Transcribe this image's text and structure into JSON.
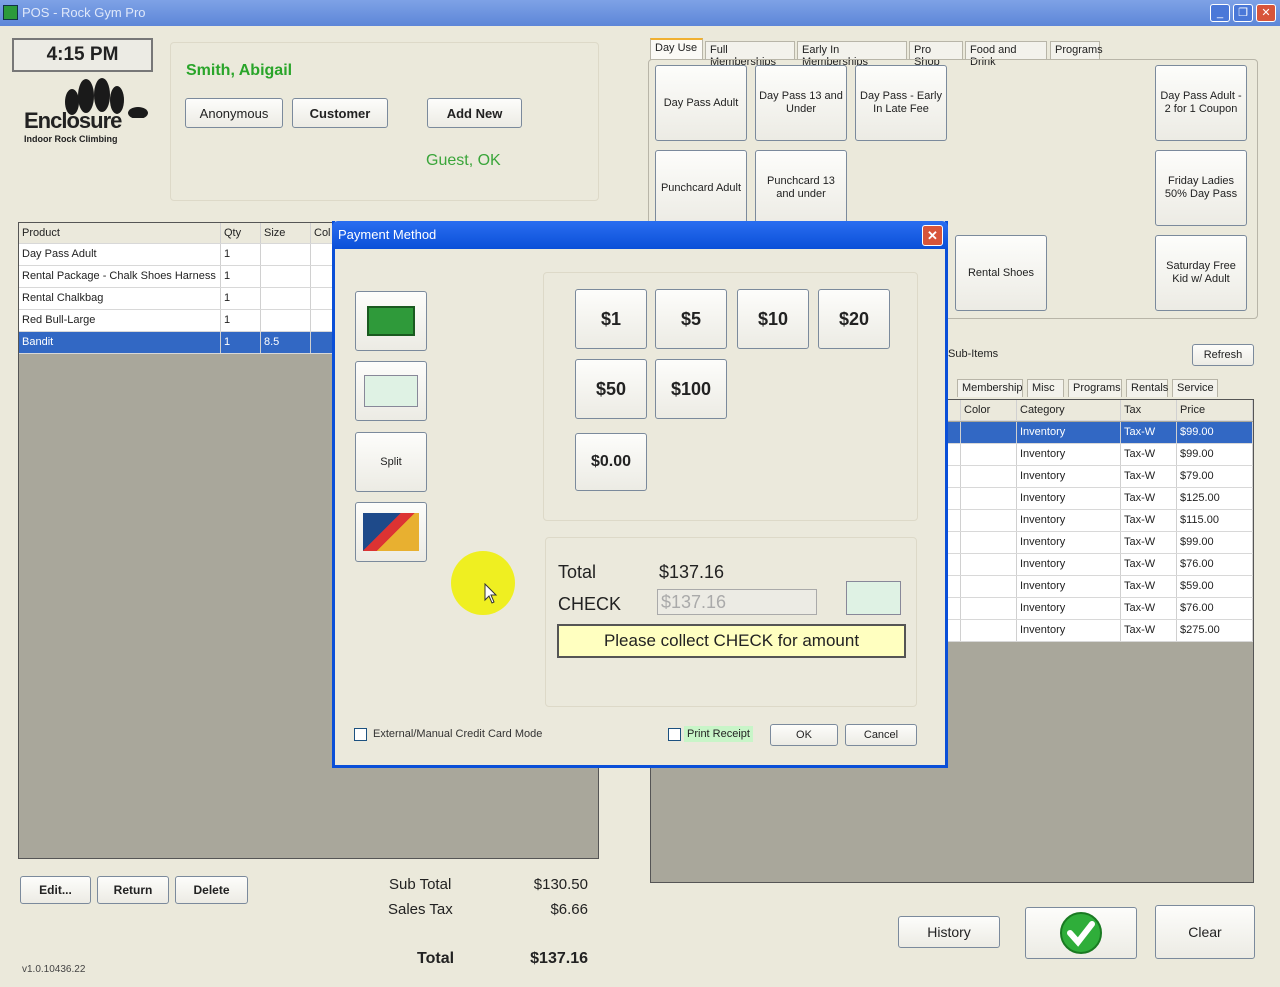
{
  "window": {
    "title": "POS - Rock Gym Pro",
    "controls": [
      "_",
      "❐",
      "✕"
    ]
  },
  "clock": "4:15 PM",
  "logo": {
    "name": "Enclosure",
    "tagline": "Indoor Rock Climbing"
  },
  "customer": {
    "name": "Smith, Abigail",
    "anonymous": "Anonymous",
    "customer": "Customer",
    "add_new": "Add New",
    "status": "Guest, OK"
  },
  "cart": {
    "columns": [
      "Product",
      "Qty",
      "Size",
      "Col"
    ],
    "rows": [
      [
        "Day Pass Adult",
        "1",
        ""
      ],
      [
        "Rental Package - Chalk Shoes Harness",
        "1",
        ""
      ],
      [
        "Rental Chalkbag",
        "1",
        ""
      ],
      [
        "Red Bull-Large",
        "1",
        ""
      ],
      [
        "Bandit",
        "1",
        "8.5"
      ]
    ]
  },
  "cart_actions": {
    "edit": "Edit...",
    "return": "Return",
    "delete": "Delete"
  },
  "totals": {
    "subtotal_label": "Sub Total",
    "subtotal": "$130.50",
    "tax_label": "Sales Tax",
    "tax": "$6.66",
    "total_label": "Total",
    "total": "$137.16"
  },
  "version": "v1.0.10436.22",
  "tabs": [
    "Day Use",
    "Full Memberships",
    "Early In Memberships",
    "Pro Shop",
    "Food and Drink",
    "Programs"
  ],
  "products": [
    "Day Pass Adult",
    "Day Pass 13 and Under",
    "Day Pass - Early In Late Fee",
    "Day Pass Adult - 2 for 1 Coupon",
    "Punchcard Adult",
    "Punchcard 13 and under",
    "Friday Ladies 50% Day Pass",
    "Rental Shoes",
    "Saturday Free Kid w/ Adult"
  ],
  "subitems": {
    "label": "Sub-Items",
    "refresh": "Refresh",
    "tabs": [
      "Membership",
      "Misc",
      "Programs",
      "Rentals",
      "Service"
    ],
    "columns": [
      "Color",
      "Category",
      "Tax",
      "Price"
    ],
    "rows": [
      [
        "",
        "Inventory",
        "Tax-W",
        "$99.00"
      ],
      [
        "",
        "Inventory",
        "Tax-W",
        "$99.00"
      ],
      [
        "",
        "Inventory",
        "Tax-W",
        "$79.00"
      ],
      [
        "",
        "Inventory",
        "Tax-W",
        "$125.00"
      ],
      [
        "",
        "Inventory",
        "Tax-W",
        "$115.00"
      ],
      [
        "",
        "Inventory",
        "Tax-W",
        "$99.00"
      ],
      [
        "",
        "Inventory",
        "Tax-W",
        "$76.00"
      ],
      [
        "",
        "Inventory",
        "Tax-W",
        "$59.00"
      ],
      [
        "",
        "Inventory",
        "Tax-W",
        "$76.00"
      ],
      [
        "",
        "Inventory",
        "Tax-W",
        "$275.00"
      ]
    ]
  },
  "bottom": {
    "history": "History",
    "clear": "Clear"
  },
  "dialog": {
    "title": "Payment Method",
    "split": "Split",
    "cash": [
      "$1",
      "$5",
      "$10",
      "$20",
      "$50",
      "$100",
      "$0.00"
    ],
    "total_label": "Total",
    "total": "$137.16",
    "method_label": "CHECK",
    "amount": "$137.16",
    "message": "Please collect CHECK for amount",
    "external_mode": "External/Manual Credit Card Mode",
    "print_receipt": "Print Receipt",
    "ok": "OK",
    "cancel": "Cancel"
  },
  "colors": {
    "accent": "#0a4fd8",
    "selection": "#3268c4",
    "customer_green": "#2aa52a",
    "message_bg": "#ffffc0"
  }
}
